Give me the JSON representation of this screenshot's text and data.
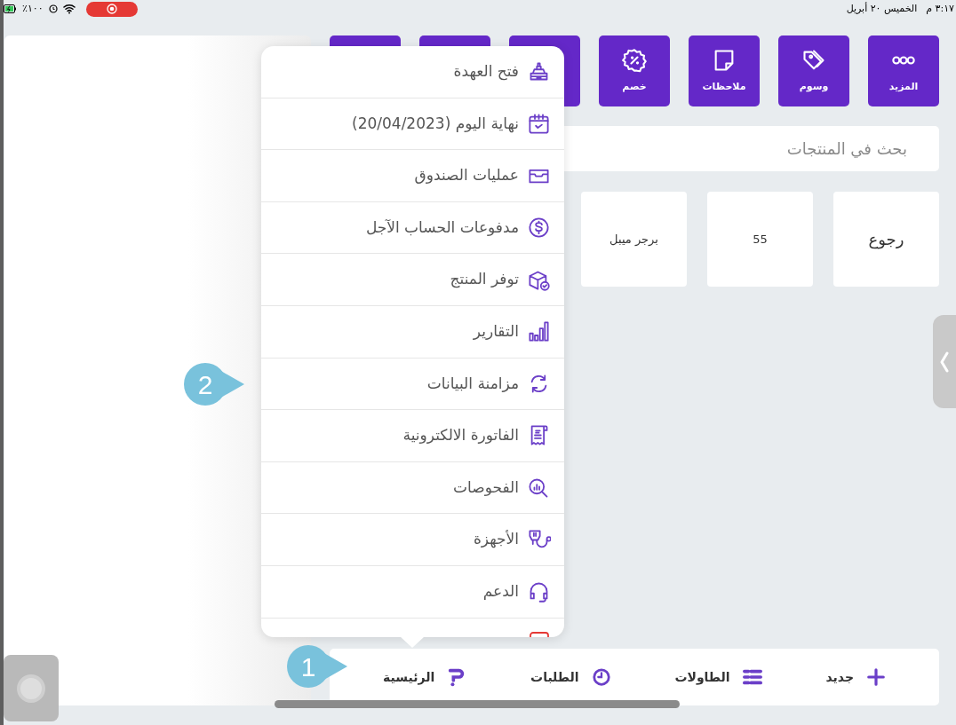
{
  "status_bar": {
    "time": "٣:١٧ م",
    "date": "الخميس ٢٠ أبريل",
    "battery": "٪١٠٠"
  },
  "toolbar": [
    {
      "kind": "more",
      "label": "المزيد"
    },
    {
      "kind": "tags",
      "label": "وسوم"
    },
    {
      "kind": "notes",
      "label": "ملاحظات"
    },
    {
      "kind": "discount",
      "label": "خصم"
    },
    {
      "kind": "covered"
    },
    {
      "kind": "covered"
    },
    {
      "kind": "covered"
    }
  ],
  "search": {
    "placeholder": "بحث في المنتجات"
  },
  "products": [
    "رجوع",
    "55",
    "برجر ميبل"
  ],
  "menu": {
    "items": [
      {
        "kind": "register",
        "label": "فتح العهدة"
      },
      {
        "kind": "calendar",
        "label": "نهاية اليوم (20/04/2023)"
      },
      {
        "kind": "drawer",
        "label": "عمليات الصندوق"
      },
      {
        "kind": "dollar",
        "label": "مدفوعات الحساب الآجل"
      },
      {
        "kind": "package",
        "label": "توفر المنتج"
      },
      {
        "kind": "reports",
        "label": "التقارير"
      },
      {
        "kind": "sync",
        "label": "مزامنة البيانات"
      },
      {
        "kind": "invoice",
        "label": "الفاتورة الالكترونية"
      },
      {
        "kind": "inspect",
        "label": "الفحوصات"
      },
      {
        "kind": "devices",
        "label": "الأجهزة"
      },
      {
        "kind": "support",
        "label": "الدعم"
      },
      {
        "kind": "cut"
      }
    ]
  },
  "bottom_nav": [
    {
      "kind": "add",
      "label": "جديد"
    },
    {
      "kind": "tables",
      "label": "الطاولات"
    },
    {
      "kind": "orders",
      "label": "الطلبات"
    },
    {
      "kind": "home",
      "label": "الرئيسية"
    }
  ],
  "callouts": [
    "1",
    "2"
  ]
}
